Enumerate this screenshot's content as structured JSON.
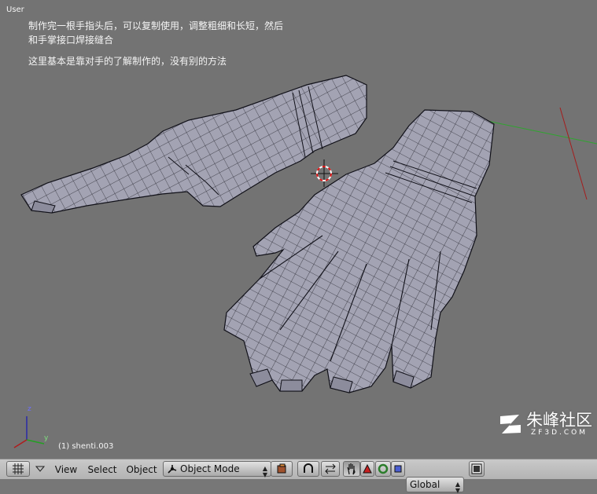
{
  "viewport": {
    "view_name": "User",
    "note_line1": "制作完一根手指头后，可以复制使用，调整粗细和长短，然后和手掌接口焊接缝合",
    "note_line2": "这里基本是靠对手的了解制作的，没有别的方法",
    "object_name": "(1) shenti.003",
    "axis_z": "z",
    "axis_y": "y",
    "watermark_main": "朱峰社区",
    "watermark_sub": "ZF3D.COM"
  },
  "toolbar": {
    "view_menu": "View",
    "select_menu": "Select",
    "object_menu": "Object",
    "mode_value": "Object Mode",
    "orientation_value": "Global"
  },
  "icons": {
    "editor_type": "grid-icon",
    "menu_collapse": "triangle-down-icon",
    "mode": "object-mode-icon",
    "shading": "solid-sphere-icon",
    "pivot": "pivot-icon",
    "snap_stepper": "arrows-icon",
    "manipulator_toggle": "hand-icon",
    "translate": "triangle-icon",
    "rotate": "circle-icon",
    "scale": "square-icon",
    "render": "render-icon"
  },
  "colors": {
    "viewport_bg": "#737373",
    "mesh_fill": "#a3a3b3",
    "mesh_wire": "#101018",
    "text": "#f4f4f4",
    "x_axis": "#a61c1c",
    "y_axis": "#2fa52f",
    "toolbar_bg": "#bdbdbd"
  }
}
